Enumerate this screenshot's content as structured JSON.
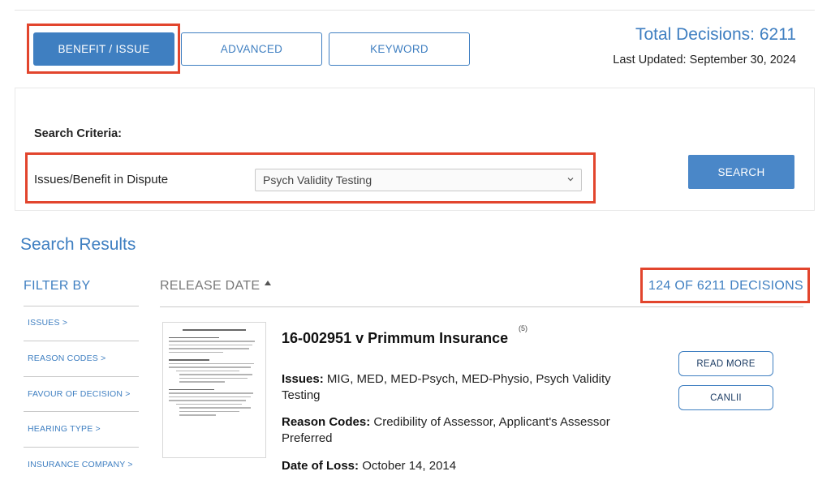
{
  "tabs": {
    "benefit_issue": "BENEFIT / ISSUE",
    "advanced": "ADVANCED",
    "keyword": "KEYWORD"
  },
  "stats": {
    "total_decisions": "Total Decisions: 6211",
    "last_updated": "Last Updated: September 30, 2024"
  },
  "criteria": {
    "title": "Search Criteria:",
    "label": "Issues/Benefit in Dispute",
    "selected": "Psych Validity Testing",
    "search_button": "SEARCH"
  },
  "results": {
    "title": "Search Results",
    "filter_by": "FILTER BY",
    "filters": [
      "ISSUES >",
      "REASON CODES >",
      "FAVOUR OF DECISION >",
      "HEARING TYPE >",
      "INSURANCE COMPANY >"
    ],
    "sort_label": "RELEASE DATE",
    "count": "124 OF 6211 DECISIONS"
  },
  "decision": {
    "title": "16-002951 v Primmum Insurance",
    "badge": "(5)",
    "issues_label": "Issues:",
    "issues": "MIG, MED, MED-Psych, MED-Physio, Psych Validity Testing",
    "reason_label": "Reason Codes:",
    "reasons": "Credibility of Assessor, Applicant's Assessor Preferred",
    "loss_label": "Date of Loss:",
    "loss_date": "October 14, 2014",
    "read_more": "READ MORE",
    "canlii": "CANLII"
  },
  "colors": {
    "accent": "#3f7fc1",
    "highlight": "#e2452d"
  }
}
